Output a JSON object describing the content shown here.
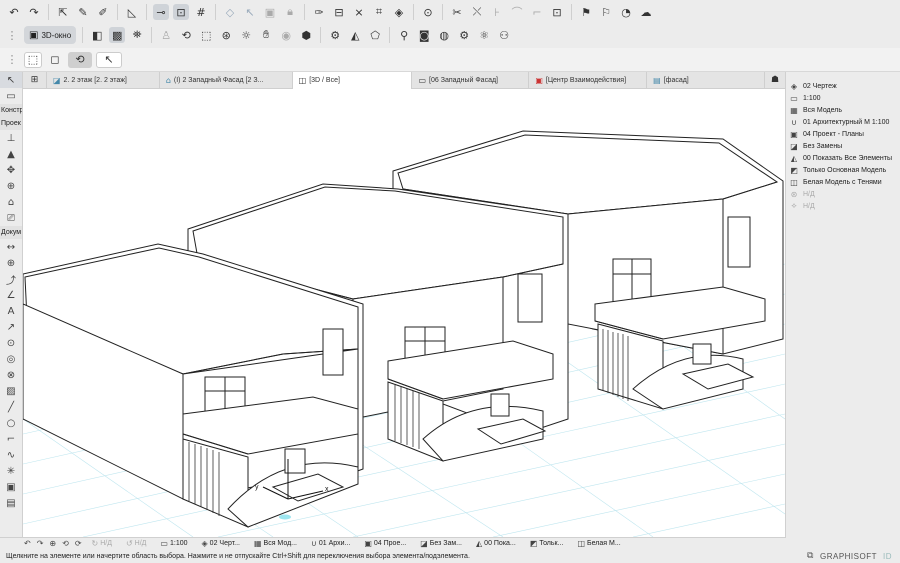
{
  "toolbar1": {
    "icons": [
      "undo-icon",
      "redo-icon",
      "pick-icon",
      "inject-icon",
      "eyedropper-icon",
      "measure-icon",
      "guide-line-icon",
      "snap-guide-icon",
      "grid-snap-icon",
      "eraser-icon",
      "select-icon",
      "group-icon",
      "lock-icon",
      "edit-icon",
      "trim-icon",
      "intersect-icon",
      "adjust-icon",
      "offset-icon",
      "scissors-icon",
      "split-icon",
      "fillet-icon",
      "curve-icon",
      "resize-icon",
      "flag-icon",
      "flag-check-icon",
      "rotate-icon",
      "cloud-icon"
    ]
  },
  "toolbar2": {
    "view_3d_label": "3D-окно",
    "icons": [
      "cube-icon",
      "cube-filled-icon",
      "walk-icon",
      "figure-icon",
      "orbit-icon",
      "camera-rig-icon",
      "explore-icon",
      "sun-icon",
      "eye-icon",
      "cube-check-icon",
      "gear-cube-icon",
      "light-cube-icon",
      "cube-arrow-icon",
      "lamp-icon",
      "photo-camera-icon",
      "render-icon",
      "settings-cube-icon",
      "render-settings-icon"
    ]
  },
  "toolbar3": {
    "icons": [
      "marquee-plus-icon",
      "marquee-icon",
      "arrow-select-icon",
      "rotate-view-icon",
      "pointer-icon"
    ]
  },
  "left_toolbox": {
    "label_construct": "Констр",
    "label_project": "Проек",
    "label_document": "Докум",
    "icons_top": [
      "arrow-tool-icon",
      "marquee-tool-icon"
    ],
    "icons_construct": [
      "wall-icon",
      "slab-icon",
      "column-icon",
      "object-icon",
      "window-icon",
      "camera-icon"
    ],
    "icons_document": [
      "dimension-icon",
      "radial-dim-icon",
      "level-dim-icon",
      "angle-dim-icon",
      "text-icon",
      "label-icon",
      "section-marker-icon",
      "globe-icon",
      "fill-icon",
      "line-icon",
      "circle-icon",
      "polyline-icon",
      "spline-icon",
      "hotspot-icon",
      "figure-tool-icon",
      "drawing-icon"
    ]
  },
  "tabs": [
    {
      "label": "2. 2 этаж [2. 2 этаж]",
      "icon": "floor-plan-icon",
      "active": false
    },
    {
      "label": "(I) 2 Западный Фасад [2 З...",
      "icon": "elevation-icon",
      "active": false
    },
    {
      "label": "[3D / Все]",
      "icon": "cube-tab-icon",
      "active": true
    },
    {
      "label": "[06 Западный Фасад]",
      "icon": "layout-icon",
      "active": false
    },
    {
      "label": "[Центр Взаимодействия]",
      "icon": "collab-icon",
      "active": false
    },
    {
      "label": "[фасад]",
      "icon": "sheet-icon",
      "active": false
    }
  ],
  "right_panel": {
    "items": [
      {
        "label": "02 Чертеж",
        "icon": "layers-icon",
        "disabled": false
      },
      {
        "label": "1:100",
        "icon": "scale-icon",
        "disabled": false
      },
      {
        "label": "Вся Модель",
        "icon": "model-icon",
        "disabled": false
      },
      {
        "label": "01 Архитектурный М 1:100",
        "icon": "pen-icon",
        "disabled": false
      },
      {
        "label": "04 Проект - Планы",
        "icon": "plan-icon",
        "disabled": false
      },
      {
        "label": "Без Замены",
        "icon": "override-icon",
        "disabled": false
      },
      {
        "label": "00 Показать Все Элементы",
        "icon": "show-icon",
        "disabled": false
      },
      {
        "label": "Только Основная Модель",
        "icon": "filter-icon",
        "disabled": false
      },
      {
        "label": "Белая Модель с Тенями",
        "icon": "style-icon",
        "disabled": false
      },
      {
        "label": "Н/Д",
        "icon": "na-icon",
        "disabled": true
      },
      {
        "label": "Н/Д",
        "icon": "na2-icon",
        "disabled": true
      }
    ]
  },
  "bottom_bar": {
    "items": [
      {
        "label": "",
        "icon": "undo-view-icon",
        "disabled": false
      },
      {
        "label": "",
        "icon": "redo-view-icon",
        "disabled": false
      },
      {
        "label": "",
        "icon": "zoom-icon",
        "disabled": false
      },
      {
        "label": "",
        "icon": "orbit-mini-icon",
        "disabled": false
      },
      {
        "label": "",
        "icon": "walk-mini-icon",
        "disabled": false
      },
      {
        "label": "Н/Д",
        "icon": "na-mini-icon",
        "disabled": true
      },
      {
        "label": "Н/Д",
        "icon": "na-mini2-icon",
        "disabled": true
      },
      {
        "label": "1:100",
        "icon": "scale-mini-icon",
        "disabled": false
      },
      {
        "label": "02 Черт...",
        "icon": "layer-mini-icon",
        "disabled": false
      },
      {
        "label": "Вся Мод...",
        "icon": "model-mini-icon",
        "disabled": false
      },
      {
        "label": "01 Архи...",
        "icon": "pen-mini-icon",
        "disabled": false
      },
      {
        "label": "04 Прое...",
        "icon": "plan-mini-icon",
        "disabled": false
      },
      {
        "label": "Без Зам...",
        "icon": "override-mini-icon",
        "disabled": false
      },
      {
        "label": "00 Пока...",
        "icon": "show-mini-icon",
        "disabled": false
      },
      {
        "label": "Тольк...",
        "icon": "filter-mini-icon",
        "disabled": false
      },
      {
        "label": "Белая М...",
        "icon": "style-mini-icon",
        "disabled": false
      }
    ]
  },
  "status": {
    "text": "Щелкните на элементе или начертите область выбора. Нажмите и не отпускайте Ctrl+Shift для переключения выбора элемента/подэлемента."
  },
  "brand": {
    "name": "GRAPHISOFT",
    "id": "ID"
  },
  "canvas": {
    "axis_x_label": "x",
    "axis_y_label": "y"
  }
}
